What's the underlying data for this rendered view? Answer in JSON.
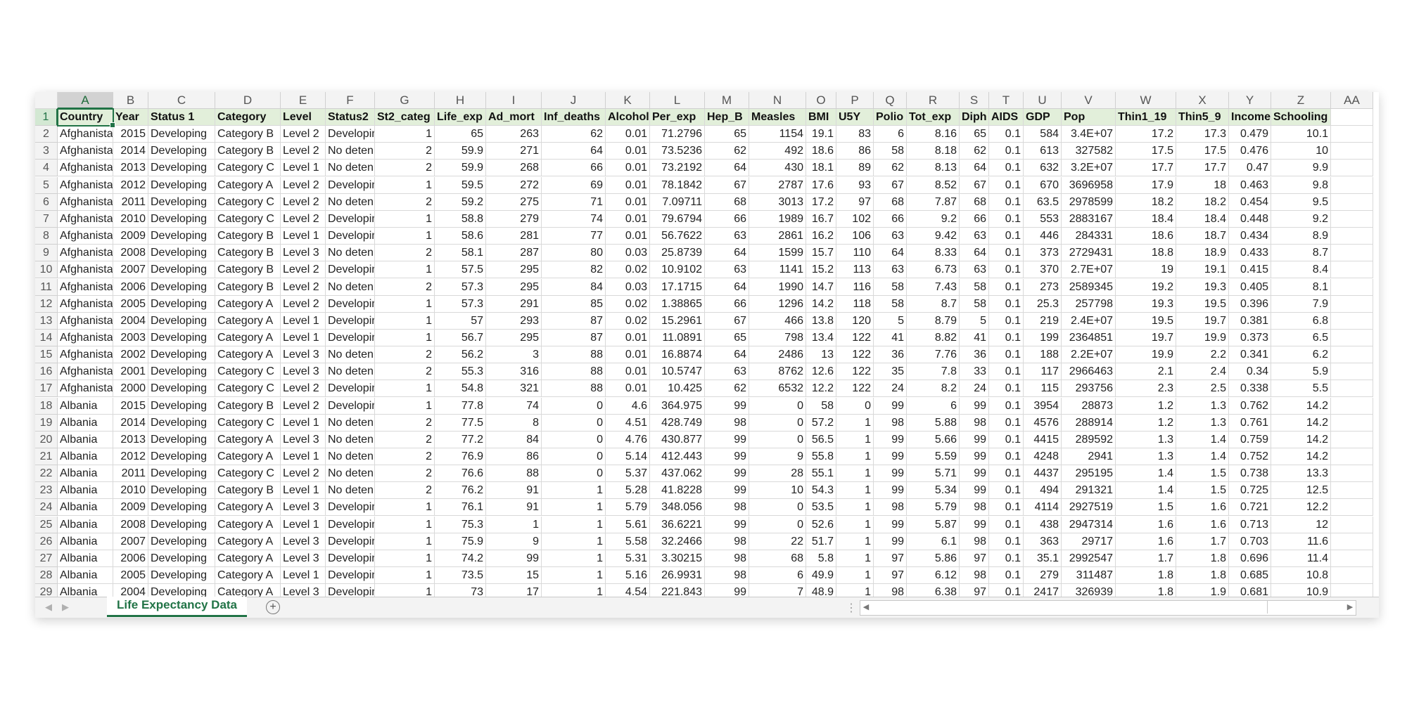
{
  "sheet": {
    "tab_name": "Life Expectancy Data",
    "selected_cell": "A1",
    "accent_color": "#217346",
    "header_fill": "#e2efda"
  },
  "column_letters": [
    "A",
    "B",
    "C",
    "D",
    "E",
    "F",
    "G",
    "H",
    "I",
    "J",
    "K",
    "L",
    "M",
    "N",
    "O",
    "P",
    "Q",
    "R",
    "S",
    "T",
    "U",
    "V",
    "W",
    "X",
    "Y",
    "Z",
    "AA"
  ],
  "headers": [
    "Country",
    "Year",
    "Status 1",
    "Category",
    "Level",
    "Status2",
    "St2_categ",
    "Life_exp",
    "Ad_mort",
    "Inf_deaths",
    "Alcohol",
    "Per_exp",
    "Hep_B",
    "Measles",
    "BMI",
    "U5Y",
    "Polio",
    "Tot_exp",
    "Diph",
    "AIDS",
    "GDP",
    "Pop",
    "Thin1_19",
    "Thin5_9",
    "Income",
    "Schooling"
  ],
  "rows": [
    [
      "Afghanistan",
      "2015",
      "Developing",
      "Category B",
      "Level 2",
      "Developing",
      "1",
      "65",
      "263",
      "62",
      "0.01",
      "71.2796",
      "65",
      "1154",
      "19.1",
      "83",
      "6",
      "8.16",
      "65",
      "0.1",
      "584",
      "3.4E+07",
      "17.2",
      "17.3",
      "0.479",
      "10.1"
    ],
    [
      "Afghanistan",
      "2014",
      "Developing",
      "Category B",
      "Level 2",
      "No deten",
      "2",
      "59.9",
      "271",
      "64",
      "0.01",
      "73.5236",
      "62",
      "492",
      "18.6",
      "86",
      "58",
      "8.18",
      "62",
      "0.1",
      "613",
      "327582",
      "17.5",
      "17.5",
      "0.476",
      "10"
    ],
    [
      "Afghanistan",
      "2013",
      "Developing",
      "Category C",
      "Level 1",
      "No deten",
      "2",
      "59.9",
      "268",
      "66",
      "0.01",
      "73.2192",
      "64",
      "430",
      "18.1",
      "89",
      "62",
      "8.13",
      "64",
      "0.1",
      "632",
      "3.2E+07",
      "17.7",
      "17.7",
      "0.47",
      "9.9"
    ],
    [
      "Afghanistan",
      "2012",
      "Developing",
      "Category A",
      "Level 2",
      "Developing",
      "1",
      "59.5",
      "272",
      "69",
      "0.01",
      "78.1842",
      "67",
      "2787",
      "17.6",
      "93",
      "67",
      "8.52",
      "67",
      "0.1",
      "670",
      "3696958",
      "17.9",
      "18",
      "0.463",
      "9.8"
    ],
    [
      "Afghanistan",
      "2011",
      "Developing",
      "Category C",
      "Level 2",
      "No deten",
      "2",
      "59.2",
      "275",
      "71",
      "0.01",
      "7.09711",
      "68",
      "3013",
      "17.2",
      "97",
      "68",
      "7.87",
      "68",
      "0.1",
      "63.5",
      "2978599",
      "18.2",
      "18.2",
      "0.454",
      "9.5"
    ],
    [
      "Afghanistan",
      "2010",
      "Developing",
      "Category C",
      "Level 2",
      "Developing",
      "1",
      "58.8",
      "279",
      "74",
      "0.01",
      "79.6794",
      "66",
      "1989",
      "16.7",
      "102",
      "66",
      "9.2",
      "66",
      "0.1",
      "553",
      "2883167",
      "18.4",
      "18.4",
      "0.448",
      "9.2"
    ],
    [
      "Afghanistan",
      "2009",
      "Developing",
      "Category B",
      "Level 1",
      "Developing",
      "1",
      "58.6",
      "281",
      "77",
      "0.01",
      "56.7622",
      "63",
      "2861",
      "16.2",
      "106",
      "63",
      "9.42",
      "63",
      "0.1",
      "446",
      "284331",
      "18.6",
      "18.7",
      "0.434",
      "8.9"
    ],
    [
      "Afghanistan",
      "2008",
      "Developing",
      "Category B",
      "Level 3",
      "No deten",
      "2",
      "58.1",
      "287",
      "80",
      "0.03",
      "25.8739",
      "64",
      "1599",
      "15.7",
      "110",
      "64",
      "8.33",
      "64",
      "0.1",
      "373",
      "2729431",
      "18.8",
      "18.9",
      "0.433",
      "8.7"
    ],
    [
      "Afghanistan",
      "2007",
      "Developing",
      "Category B",
      "Level 2",
      "Developing",
      "1",
      "57.5",
      "295",
      "82",
      "0.02",
      "10.9102",
      "63",
      "1141",
      "15.2",
      "113",
      "63",
      "6.73",
      "63",
      "0.1",
      "370",
      "2.7E+07",
      "19",
      "19.1",
      "0.415",
      "8.4"
    ],
    [
      "Afghanistan",
      "2006",
      "Developing",
      "Category B",
      "Level 2",
      "No deten",
      "2",
      "57.3",
      "295",
      "84",
      "0.03",
      "17.1715",
      "64",
      "1990",
      "14.7",
      "116",
      "58",
      "7.43",
      "58",
      "0.1",
      "273",
      "2589345",
      "19.2",
      "19.3",
      "0.405",
      "8.1"
    ],
    [
      "Afghanistan",
      "2005",
      "Developing",
      "Category A",
      "Level 2",
      "Developing",
      "1",
      "57.3",
      "291",
      "85",
      "0.02",
      "1.38865",
      "66",
      "1296",
      "14.2",
      "118",
      "58",
      "8.7",
      "58",
      "0.1",
      "25.3",
      "257798",
      "19.3",
      "19.5",
      "0.396",
      "7.9"
    ],
    [
      "Afghanistan",
      "2004",
      "Developing",
      "Category A",
      "Level 1",
      "Developing",
      "1",
      "57",
      "293",
      "87",
      "0.02",
      "15.2961",
      "67",
      "466",
      "13.8",
      "120",
      "5",
      "8.79",
      "5",
      "0.1",
      "219",
      "2.4E+07",
      "19.5",
      "19.7",
      "0.381",
      "6.8"
    ],
    [
      "Afghanistan",
      "2003",
      "Developing",
      "Category A",
      "Level 1",
      "Developing",
      "1",
      "56.7",
      "295",
      "87",
      "0.01",
      "11.0891",
      "65",
      "798",
      "13.4",
      "122",
      "41",
      "8.82",
      "41",
      "0.1",
      "199",
      "2364851",
      "19.7",
      "19.9",
      "0.373",
      "6.5"
    ],
    [
      "Afghanistan",
      "2002",
      "Developing",
      "Category A",
      "Level 3",
      "No deten",
      "2",
      "56.2",
      "3",
      "88",
      "0.01",
      "16.8874",
      "64",
      "2486",
      "13",
      "122",
      "36",
      "7.76",
      "36",
      "0.1",
      "188",
      "2.2E+07",
      "19.9",
      "2.2",
      "0.341",
      "6.2"
    ],
    [
      "Afghanistan",
      "2001",
      "Developing",
      "Category C",
      "Level 3",
      "No deten",
      "2",
      "55.3",
      "316",
      "88",
      "0.01",
      "10.5747",
      "63",
      "8762",
      "12.6",
      "122",
      "35",
      "7.8",
      "33",
      "0.1",
      "117",
      "2966463",
      "2.1",
      "2.4",
      "0.34",
      "5.9"
    ],
    [
      "Afghanistan",
      "2000",
      "Developing",
      "Category C",
      "Level 2",
      "Developing",
      "1",
      "54.8",
      "321",
      "88",
      "0.01",
      "10.425",
      "62",
      "6532",
      "12.2",
      "122",
      "24",
      "8.2",
      "24",
      "0.1",
      "115",
      "293756",
      "2.3",
      "2.5",
      "0.338",
      "5.5"
    ],
    [
      "Albania",
      "2015",
      "Developing",
      "Category B",
      "Level 2",
      "Developing",
      "1",
      "77.8",
      "74",
      "0",
      "4.6",
      "364.975",
      "99",
      "0",
      "58",
      "0",
      "99",
      "6",
      "99",
      "0.1",
      "3954",
      "28873",
      "1.2",
      "1.3",
      "0.762",
      "14.2"
    ],
    [
      "Albania",
      "2014",
      "Developing",
      "Category C",
      "Level 1",
      "No deten",
      "2",
      "77.5",
      "8",
      "0",
      "4.51",
      "428.749",
      "98",
      "0",
      "57.2",
      "1",
      "98",
      "5.88",
      "98",
      "0.1",
      "4576",
      "288914",
      "1.2",
      "1.3",
      "0.761",
      "14.2"
    ],
    [
      "Albania",
      "2013",
      "Developing",
      "Category A",
      "Level 3",
      "No deten",
      "2",
      "77.2",
      "84",
      "0",
      "4.76",
      "430.877",
      "99",
      "0",
      "56.5",
      "1",
      "99",
      "5.66",
      "99",
      "0.1",
      "4415",
      "289592",
      "1.3",
      "1.4",
      "0.759",
      "14.2"
    ],
    [
      "Albania",
      "2012",
      "Developing",
      "Category A",
      "Level 1",
      "No deten",
      "2",
      "76.9",
      "86",
      "0",
      "5.14",
      "412.443",
      "99",
      "9",
      "55.8",
      "1",
      "99",
      "5.59",
      "99",
      "0.1",
      "4248",
      "2941",
      "1.3",
      "1.4",
      "0.752",
      "14.2"
    ],
    [
      "Albania",
      "2011",
      "Developing",
      "Category C",
      "Level 2",
      "No deten",
      "2",
      "76.6",
      "88",
      "0",
      "5.37",
      "437.062",
      "99",
      "28",
      "55.1",
      "1",
      "99",
      "5.71",
      "99",
      "0.1",
      "4437",
      "295195",
      "1.4",
      "1.5",
      "0.738",
      "13.3"
    ],
    [
      "Albania",
      "2010",
      "Developing",
      "Category B",
      "Level 1",
      "No deten",
      "2",
      "76.2",
      "91",
      "1",
      "5.28",
      "41.8228",
      "99",
      "10",
      "54.3",
      "1",
      "99",
      "5.34",
      "99",
      "0.1",
      "494",
      "291321",
      "1.4",
      "1.5",
      "0.725",
      "12.5"
    ],
    [
      "Albania",
      "2009",
      "Developing",
      "Category A",
      "Level 3",
      "Developing",
      "1",
      "76.1",
      "91",
      "1",
      "5.79",
      "348.056",
      "98",
      "0",
      "53.5",
      "1",
      "98",
      "5.79",
      "98",
      "0.1",
      "4114",
      "2927519",
      "1.5",
      "1.6",
      "0.721",
      "12.2"
    ],
    [
      "Albania",
      "2008",
      "Developing",
      "Category A",
      "Level 1",
      "Developing",
      "1",
      "75.3",
      "1",
      "1",
      "5.61",
      "36.6221",
      "99",
      "0",
      "52.6",
      "1",
      "99",
      "5.87",
      "99",
      "0.1",
      "438",
      "2947314",
      "1.6",
      "1.6",
      "0.713",
      "12"
    ],
    [
      "Albania",
      "2007",
      "Developing",
      "Category A",
      "Level 3",
      "Developing",
      "1",
      "75.9",
      "9",
      "1",
      "5.58",
      "32.2466",
      "98",
      "22",
      "51.7",
      "1",
      "99",
      "6.1",
      "98",
      "0.1",
      "363",
      "29717",
      "1.6",
      "1.7",
      "0.703",
      "11.6"
    ],
    [
      "Albania",
      "2006",
      "Developing",
      "Category A",
      "Level 3",
      "Developing",
      "1",
      "74.2",
      "99",
      "1",
      "5.31",
      "3.30215",
      "98",
      "68",
      "5.8",
      "1",
      "97",
      "5.86",
      "97",
      "0.1",
      "35.1",
      "2992547",
      "1.7",
      "1.8",
      "0.696",
      "11.4"
    ],
    [
      "Albania",
      "2005",
      "Developing",
      "Category A",
      "Level 1",
      "Developing",
      "1",
      "73.5",
      "15",
      "1",
      "5.16",
      "26.9931",
      "98",
      "6",
      "49.9",
      "1",
      "97",
      "6.12",
      "98",
      "0.1",
      "279",
      "311487",
      "1.8",
      "1.8",
      "0.685",
      "10.8"
    ],
    [
      "Albania",
      "2004",
      "Developing",
      "Category A",
      "Level 3",
      "Developing",
      "1",
      "73",
      "17",
      "1",
      "4.54",
      "221.843",
      "99",
      "7",
      "48.9",
      "1",
      "98",
      "6.38",
      "97",
      "0.1",
      "2417",
      "326939",
      "1.8",
      "1.9",
      "0.681",
      "10.9"
    ]
  ]
}
